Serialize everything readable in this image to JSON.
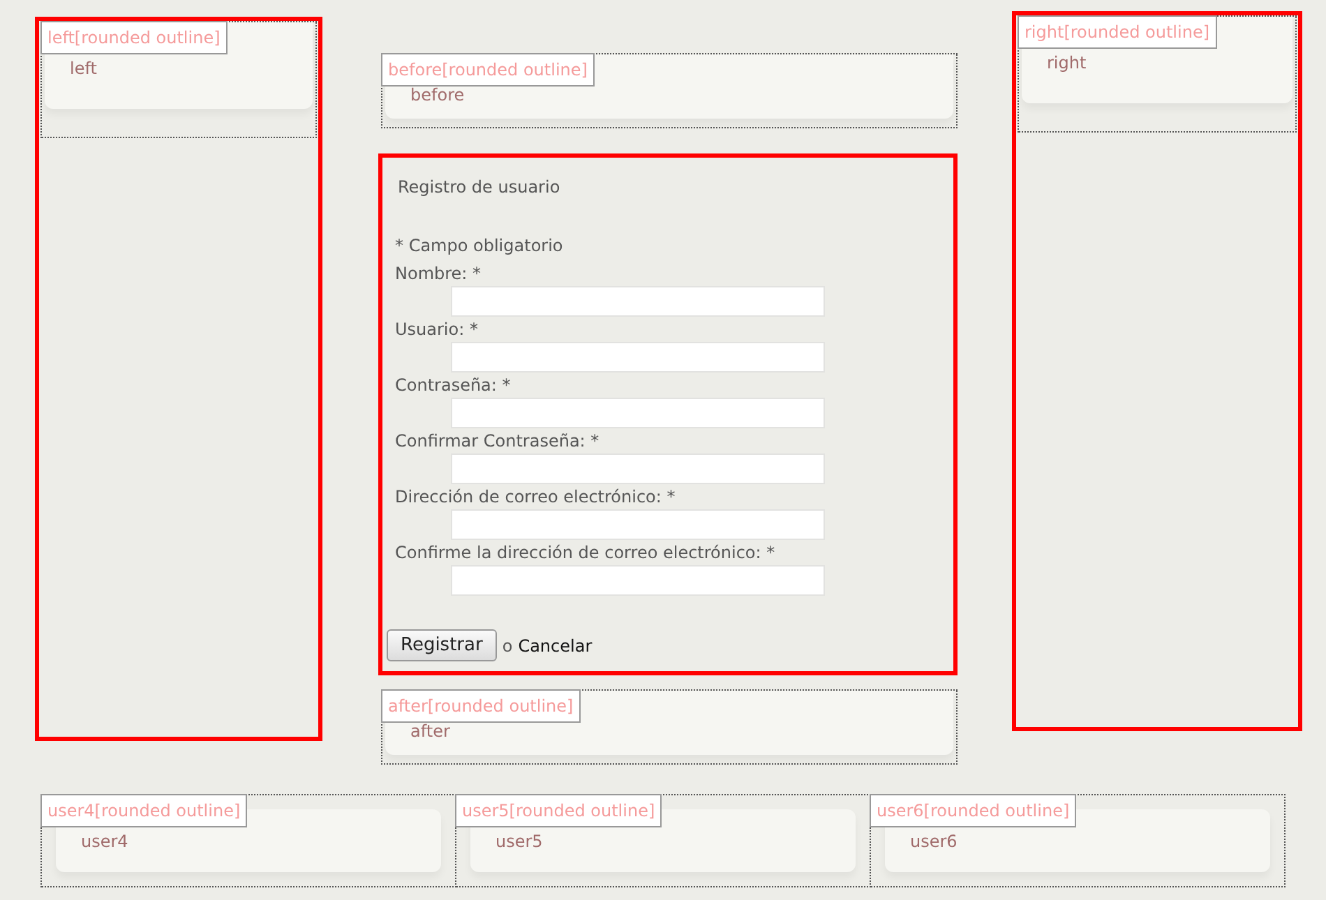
{
  "left": {
    "tag": "left[rounded outline]",
    "content": "left",
    "highlighted": true
  },
  "before": {
    "tag": "before[rounded outline]",
    "content": "before",
    "highlighted": false
  },
  "component": {
    "highlighted": true,
    "title": "Registro de usuario",
    "required_note": "* Campo obligatorio",
    "fields": [
      {
        "label": "Nombre: *"
      },
      {
        "label": "Usuario: *"
      },
      {
        "label": "Contraseña: *"
      },
      {
        "label": "Confirmar Contraseña: *"
      },
      {
        "label": "Dirección de correo electrónico: *"
      },
      {
        "label": "Confirme la dirección de correo electrónico: *"
      }
    ],
    "submit": "Registrar",
    "separator": "o",
    "cancel": "Cancelar"
  },
  "after": {
    "tag": "after[rounded outline]",
    "content": "after",
    "highlighted": false
  },
  "right": {
    "tag": "right[rounded outline]",
    "content": "right",
    "highlighted": true
  },
  "bottom_modules": [
    {
      "tag": "user4[rounded outline]",
      "content": "user4"
    },
    {
      "tag": "user5[rounded outline]",
      "content": "user5"
    },
    {
      "tag": "user6[rounded outline]",
      "content": "user6"
    }
  ]
}
